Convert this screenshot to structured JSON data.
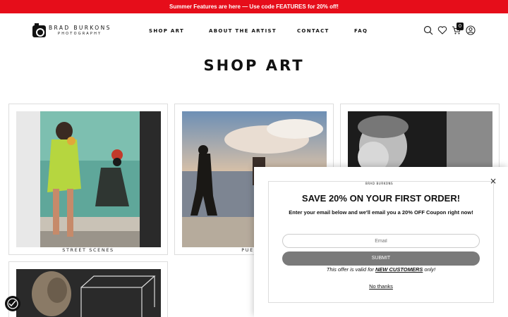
{
  "announcement": "Summer Features are here — Use code FEATURES for 20% off!",
  "brand": {
    "name": "BRAD BURKONS",
    "tagline": "PHOTOGRAPHY"
  },
  "nav": {
    "shop": "SHOP ART",
    "about": "ABOUT THE ARTIST",
    "contact": "CONTACT",
    "faq": "FAQ"
  },
  "header_icons": [
    "search-icon",
    "heart-icon",
    "cart-icon",
    "account-icon"
  ],
  "cart_count": "0",
  "page_title": "SHOP ART",
  "cards": [
    {
      "label": "STREET SCENES"
    },
    {
      "label": "PUERTO"
    },
    {
      "label": ""
    },
    {
      "label": ""
    }
  ],
  "popup": {
    "heading": "SAVE 20% ON YOUR FIRST ORDER!",
    "body": "Enter your email below and we'll email you a 20% OFF Coupon right now!",
    "email_placeholder": "Email",
    "submit": "SUBMIT",
    "offer_prefix": "This offer is valid for ",
    "offer_bold": "NEW CUSTOMERS",
    "offer_suffix": " only!",
    "decline": "No thanks",
    "close": "×"
  },
  "colors": {
    "announcement_bg": "#e60d1a",
    "submit_bg": "#7a7a7a"
  }
}
